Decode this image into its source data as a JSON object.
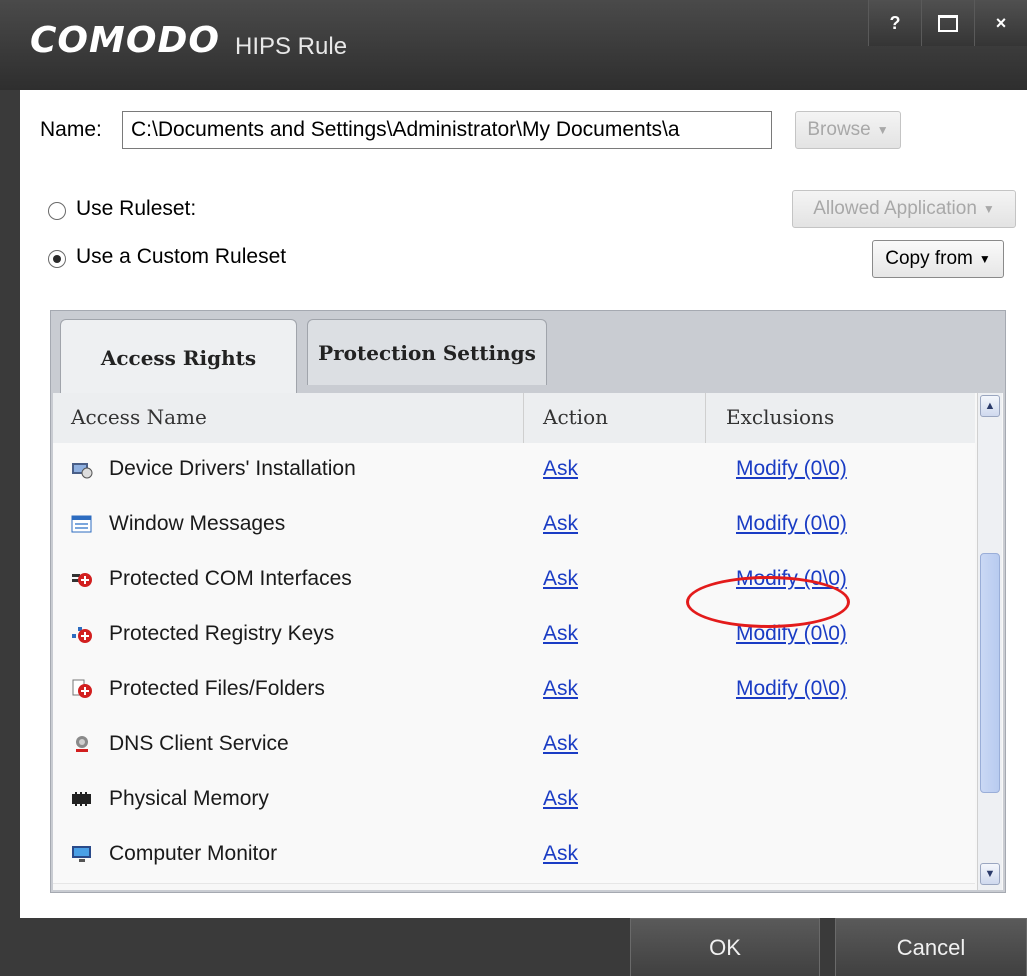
{
  "window": {
    "brand": "COMODO",
    "subtitle": "HIPS Rule",
    "help_label": "?",
    "close_label": "×"
  },
  "form": {
    "name_label": "Name:",
    "name_value": "C:\\Documents and Settings\\Administrator\\My Documents\\a",
    "browse_label": "Browse",
    "use_ruleset_label": "Use Ruleset:",
    "ruleset_value": "Allowed Application",
    "use_custom_label": "Use a Custom Ruleset",
    "copy_from_label": "Copy from",
    "selected_option": "Use a Custom Ruleset"
  },
  "tabs": [
    {
      "label": "Access Rights",
      "active": true
    },
    {
      "label": "Protection Settings",
      "active": false
    }
  ],
  "table": {
    "headers": [
      "Access Name",
      "Action",
      "Exclusions"
    ],
    "rows": [
      {
        "name": "Device Drivers' Installation",
        "action": "Ask",
        "exclusions": "Modify (0\\0)",
        "icon": "device-driver-icon"
      },
      {
        "name": "Window Messages",
        "action": "Ask",
        "exclusions": "Modify (0\\0)",
        "icon": "window-icon"
      },
      {
        "name": "Protected COM Interfaces",
        "action": "Ask",
        "exclusions": "Modify (0\\0)",
        "icon": "com-interface-icon"
      },
      {
        "name": "Protected Registry Keys",
        "action": "Ask",
        "exclusions": "Modify (0\\0)",
        "icon": "registry-icon"
      },
      {
        "name": "Protected Files/Folders",
        "action": "Ask",
        "exclusions": "Modify (0\\0)",
        "icon": "protected-files-icon",
        "highlighted": true
      },
      {
        "name": "DNS Client Service",
        "action": "Ask",
        "exclusions": "",
        "icon": "dns-icon"
      },
      {
        "name": "Physical Memory",
        "action": "Ask",
        "exclusions": "",
        "icon": "memory-icon"
      },
      {
        "name": "Computer Monitor",
        "action": "Ask",
        "exclusions": "",
        "icon": "monitor-icon"
      }
    ]
  },
  "footer": {
    "ok_label": "OK",
    "cancel_label": "Cancel"
  },
  "colors": {
    "link": "#1a3cc4",
    "highlight": "#e31b1b",
    "titlebar": "#3a3a3a"
  }
}
